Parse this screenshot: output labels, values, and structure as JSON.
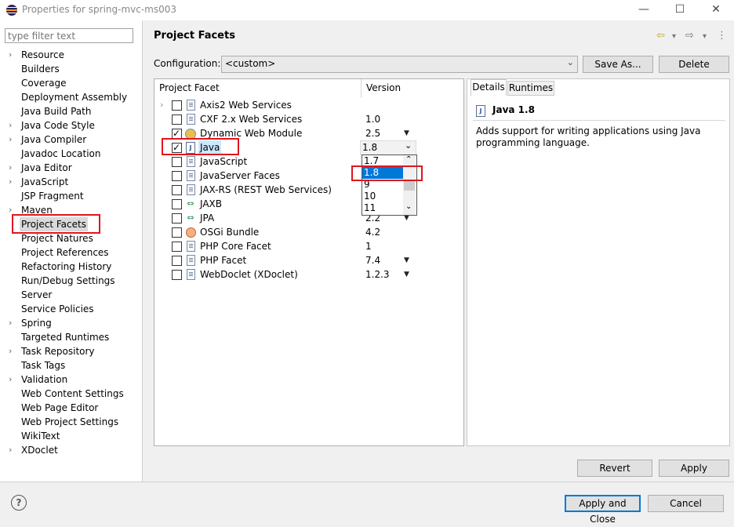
{
  "window": {
    "title": "Properties for spring-mvc-ms003",
    "minimize": "—",
    "maximize": "☐",
    "close": "✕"
  },
  "filter": {
    "placeholder": "type filter text"
  },
  "nav": [
    {
      "label": "Resource",
      "expandable": true
    },
    {
      "label": "Builders",
      "expandable": false
    },
    {
      "label": "Coverage",
      "expandable": false
    },
    {
      "label": "Deployment Assembly",
      "expandable": false
    },
    {
      "label": "Java Build Path",
      "expandable": false
    },
    {
      "label": "Java Code Style",
      "expandable": true
    },
    {
      "label": "Java Compiler",
      "expandable": true
    },
    {
      "label": "Javadoc Location",
      "expandable": false
    },
    {
      "label": "Java Editor",
      "expandable": true
    },
    {
      "label": "JavaScript",
      "expandable": true
    },
    {
      "label": "JSP Fragment",
      "expandable": false
    },
    {
      "label": "Maven",
      "expandable": true
    },
    {
      "label": "Project Facets",
      "expandable": false,
      "selected": true
    },
    {
      "label": "Project Natures",
      "expandable": false
    },
    {
      "label": "Project References",
      "expandable": false
    },
    {
      "label": "Refactoring History",
      "expandable": false
    },
    {
      "label": "Run/Debug Settings",
      "expandable": false
    },
    {
      "label": "Server",
      "expandable": false
    },
    {
      "label": "Service Policies",
      "expandable": false
    },
    {
      "label": "Spring",
      "expandable": true
    },
    {
      "label": "Targeted Runtimes",
      "expandable": false
    },
    {
      "label": "Task Repository",
      "expandable": true
    },
    {
      "label": "Task Tags",
      "expandable": false
    },
    {
      "label": "Validation",
      "expandable": true
    },
    {
      "label": "Web Content Settings",
      "expandable": false
    },
    {
      "label": "Web Page Editor",
      "expandable": false
    },
    {
      "label": "Web Project Settings",
      "expandable": false
    },
    {
      "label": "WikiText",
      "expandable": false
    },
    {
      "label": "XDoclet",
      "expandable": true
    }
  ],
  "header": {
    "title": "Project Facets",
    "back_icon": "⇦",
    "forward_icon": "⇨",
    "menu_icon": "⋮",
    "dropdown_icon": "▾"
  },
  "configuration": {
    "label": "Configuration:",
    "value": "<custom>",
    "save_as": "Save As...",
    "delete": "Delete"
  },
  "facets": {
    "col_facet": "Project Facet",
    "col_version": "Version",
    "rows": [
      {
        "name": "Axis2 Web Services",
        "version": "",
        "checked": false,
        "expander": true,
        "dropdown": false,
        "icon": "doc"
      },
      {
        "name": "CXF 2.x Web Services",
        "version": "1.0",
        "checked": false,
        "expander": false,
        "dropdown": false,
        "icon": "doc"
      },
      {
        "name": "Dynamic Web Module",
        "version": "2.5",
        "checked": true,
        "expander": false,
        "dropdown": true,
        "icon": "web"
      },
      {
        "name": "Java",
        "version": "1.8",
        "checked": true,
        "expander": false,
        "dropdown": false,
        "icon": "java",
        "selected": true
      },
      {
        "name": "JavaScript",
        "version": "",
        "checked": false,
        "expander": false,
        "dropdown": false,
        "icon": "doc"
      },
      {
        "name": "JavaServer Faces",
        "version": "",
        "checked": false,
        "expander": false,
        "dropdown": false,
        "icon": "doc"
      },
      {
        "name": "JAX-RS (REST Web Services)",
        "version": "",
        "checked": false,
        "expander": false,
        "dropdown": false,
        "icon": "doc"
      },
      {
        "name": "JAXB",
        "version": "",
        "checked": false,
        "expander": false,
        "dropdown": false,
        "icon": "swap"
      },
      {
        "name": "JPA",
        "version": "2.2",
        "checked": false,
        "expander": false,
        "dropdown": true,
        "icon": "swap"
      },
      {
        "name": "OSGi Bundle",
        "version": "4.2",
        "checked": false,
        "expander": false,
        "dropdown": false,
        "icon": "osgi"
      },
      {
        "name": "PHP Core Facet",
        "version": "1",
        "checked": false,
        "expander": false,
        "dropdown": false,
        "icon": "doc"
      },
      {
        "name": "PHP Facet",
        "version": "7.4",
        "checked": false,
        "expander": false,
        "dropdown": true,
        "icon": "doc"
      },
      {
        "name": "WebDoclet (XDoclet)",
        "version": "1.2.3",
        "checked": false,
        "expander": false,
        "dropdown": true,
        "icon": "doc"
      }
    ],
    "java_version_options": [
      "1.7",
      "1.8",
      "9",
      "10",
      "11"
    ],
    "java_version_selected": "1.8"
  },
  "details": {
    "tab_details": "Details",
    "tab_runtimes": "Runtimes",
    "title": "Java 1.8",
    "description": "Adds support for writing applications using Java programming language."
  },
  "buttons": {
    "revert": "Revert",
    "apply": "Apply",
    "apply_close": "Apply and Close",
    "cancel": "Cancel",
    "help": "?"
  },
  "colors": {
    "highlight": "#e0161d",
    "selection": "#0078d7"
  }
}
